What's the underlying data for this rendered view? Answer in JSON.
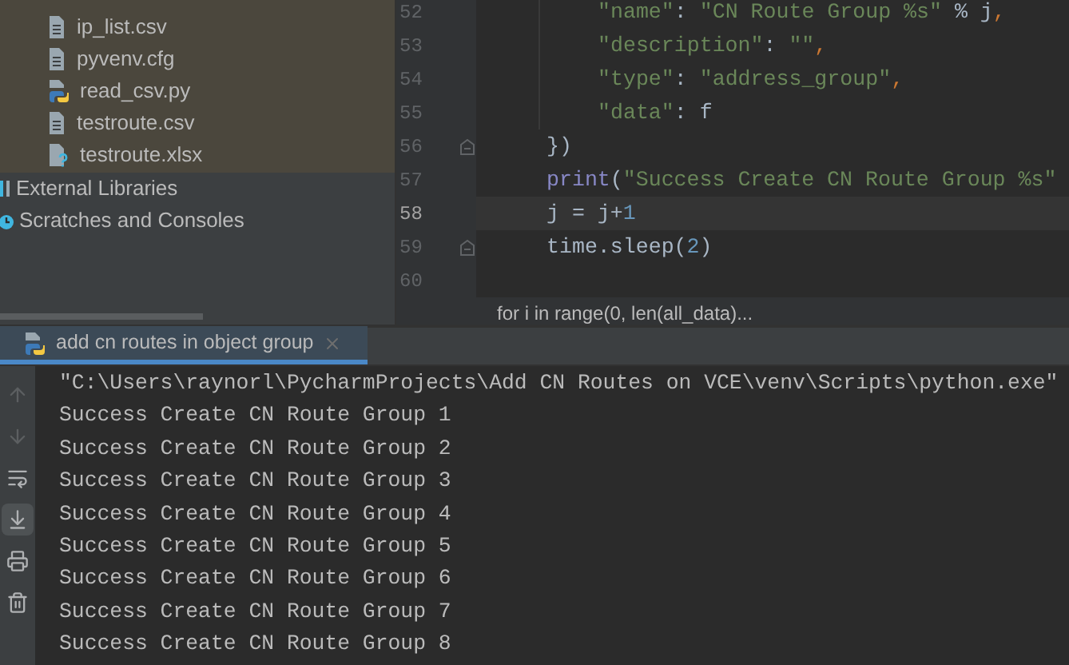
{
  "project_tree": {
    "items": [
      {
        "name": "ip_list.csv",
        "kind": "text"
      },
      {
        "name": "pyvenv.cfg",
        "kind": "text"
      },
      {
        "name": "read_csv.py",
        "kind": "python"
      },
      {
        "name": "testroute.csv",
        "kind": "text"
      },
      {
        "name": "testroute.xlsx",
        "kind": "unknown"
      }
    ],
    "roots": [
      {
        "name": "External Libraries",
        "kind": "library"
      },
      {
        "name": "Scratches and Consoles",
        "kind": "scratches"
      }
    ]
  },
  "editor": {
    "lines": [
      {
        "number": "52",
        "fold": false,
        "current": false,
        "guide": true,
        "tokens": [
          {
            "kind": "string",
            "text": "\"name\""
          },
          {
            "kind": "plain",
            "text": ": "
          },
          {
            "kind": "string",
            "text": "\"CN Route Group %s\""
          },
          {
            "kind": "plain",
            "text": " % j"
          },
          {
            "kind": "punct",
            "text": ","
          }
        ]
      },
      {
        "number": "53",
        "fold": false,
        "current": false,
        "guide": true,
        "tokens": [
          {
            "kind": "string",
            "text": "\"description\""
          },
          {
            "kind": "plain",
            "text": ": "
          },
          {
            "kind": "string",
            "text": "\"\""
          },
          {
            "kind": "punct",
            "text": ","
          }
        ]
      },
      {
        "number": "54",
        "fold": false,
        "current": false,
        "guide": true,
        "tokens": [
          {
            "kind": "string",
            "text": "\"type\""
          },
          {
            "kind": "plain",
            "text": ": "
          },
          {
            "kind": "string",
            "text": "\"address_group\""
          },
          {
            "kind": "punct",
            "text": ","
          }
        ]
      },
      {
        "number": "55",
        "fold": false,
        "current": false,
        "guide": true,
        "tokens": [
          {
            "kind": "string",
            "text": "\"data\""
          },
          {
            "kind": "plain",
            "text": ": f"
          }
        ]
      },
      {
        "number": "56",
        "fold": true,
        "current": false,
        "guide": false,
        "tokens": [
          {
            "kind": "plain",
            "text": "})"
          }
        ]
      },
      {
        "number": "57",
        "fold": false,
        "current": false,
        "guide": false,
        "tokens": [
          {
            "kind": "builtin",
            "text": "print"
          },
          {
            "kind": "plain",
            "text": "("
          },
          {
            "kind": "string",
            "text": "\"Success Create CN Route Group %s\""
          }
        ]
      },
      {
        "number": "58",
        "fold": false,
        "current": true,
        "guide": false,
        "tokens": [
          {
            "kind": "plain",
            "text": "j = j+"
          },
          {
            "kind": "number",
            "text": "1"
          }
        ]
      },
      {
        "number": "59",
        "fold": true,
        "current": false,
        "guide": false,
        "tokens": [
          {
            "kind": "plain",
            "text": "time.sleep("
          },
          {
            "kind": "number",
            "text": "2"
          },
          {
            "kind": "plain",
            "text": ")"
          }
        ]
      },
      {
        "number": "60",
        "fold": false,
        "current": false,
        "guide": false
      }
    ],
    "breadcrumb": "for i in range(0, len(all_data)..."
  },
  "run_panel": {
    "tab": {
      "label": "add cn routes in object group",
      "selected": true
    },
    "toolbar": [
      {
        "kind": "up",
        "disabled": true,
        "selected": false
      },
      {
        "kind": "down",
        "disabled": true,
        "selected": false
      },
      {
        "kind": "wrap",
        "disabled": false,
        "selected": false
      },
      {
        "kind": "scroll-end",
        "disabled": false,
        "selected": true
      },
      {
        "kind": "print",
        "disabled": false,
        "selected": false
      },
      {
        "kind": "trash",
        "disabled": false,
        "selected": false
      }
    ],
    "output": [
      "\"C:\\Users\\raynorl\\PycharmProjects\\Add CN Routes on VCE\\venv\\Scripts\\python.exe\"",
      "Success Create CN Route Group 1",
      "Success Create CN Route Group 2",
      "Success Create CN Route Group 3",
      "Success Create CN Route Group 4",
      "Success Create CN Route Group 5",
      "Success Create CN Route Group 6",
      "Success Create CN Route Group 7",
      "Success Create CN Route Group 8"
    ]
  }
}
